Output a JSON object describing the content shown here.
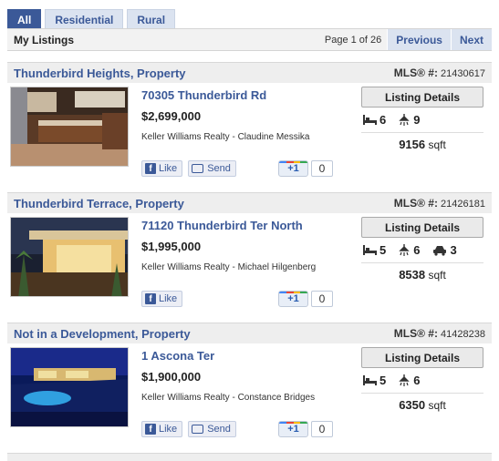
{
  "tabs": [
    {
      "label": "All",
      "active": true
    },
    {
      "label": "Residential",
      "active": false
    },
    {
      "label": "Rural",
      "active": false
    }
  ],
  "bar": {
    "title": "My Listings",
    "page_info": "Page 1 of 26",
    "previous_label": "Previous",
    "next_label": "Next"
  },
  "listings": [
    {
      "title": "Thunderbird Heights, Property",
      "mls_label": "MLS® #:",
      "mls_number": "21430617",
      "address": "70305 Thunderbird Rd",
      "price": "$2,699,000",
      "agent": "Keller Williams Realty - Claudine Messika",
      "details_label": "Listing Details",
      "beds": "6",
      "baths": "9",
      "sqft_value": "9156",
      "sqft_unit": "sqft",
      "like_label": "Like",
      "send_label": "Send",
      "plusone_label": "+1",
      "plusone_count": "0"
    },
    {
      "title": "Thunderbird Terrace, Property",
      "mls_label": "MLS® #:",
      "mls_number": "21426181",
      "address": "71120 Thunderbird Ter North",
      "price": "$1,995,000",
      "agent": "Keller Williams Realty - Michael Hilgenberg",
      "details_label": "Listing Details",
      "beds": "5",
      "baths": "6",
      "garage": "3",
      "sqft_value": "8538",
      "sqft_unit": "sqft",
      "like_label": "Like",
      "plusone_label": "+1",
      "plusone_count": "0"
    },
    {
      "title": "Not in a Development, Property",
      "mls_label": "MLS® #:",
      "mls_number": "41428238",
      "address": "1 Ascona Ter",
      "price": "$1,900,000",
      "agent": "Keller Williams Realty - Constance Bridges",
      "details_label": "Listing Details",
      "beds": "5",
      "baths": "6",
      "sqft_value": "6350",
      "sqft_unit": "sqft",
      "like_label": "Like",
      "send_label": "Send",
      "plusone_label": "+1",
      "plusone_count": "0"
    }
  ],
  "colors": {
    "link_blue": "#3b5998",
    "tab_active": "#3b5998",
    "tab_inactive": "#dbe3f0"
  }
}
